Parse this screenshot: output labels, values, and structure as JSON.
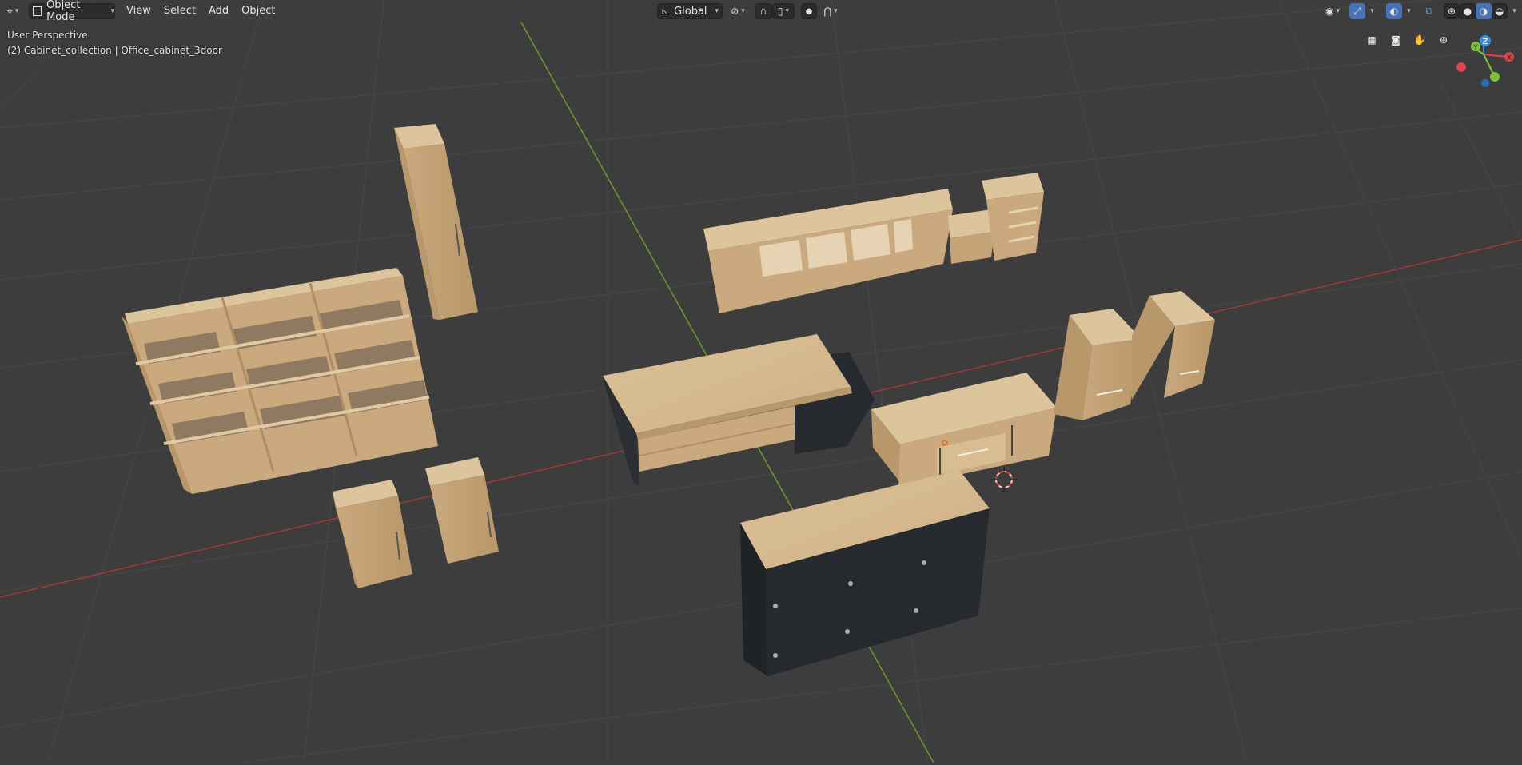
{
  "header": {
    "editor_type_icon": "axes-icon",
    "mode_label": "Object Mode",
    "menus": [
      "View",
      "Select",
      "Add",
      "Object"
    ],
    "transform_orientation": "Global"
  },
  "viewport": {
    "perspective_label": "User Perspective",
    "collection_label": "(2) Cabinet_collection | Office_cabinet_3door"
  },
  "gizmo": {
    "x_label": "X",
    "y_label": "Y",
    "z_label": "Z",
    "colors": {
      "x": "#e0424f",
      "y": "#7dc23a",
      "z": "#3d8ee0"
    }
  },
  "colors": {
    "background": "#3d3d3d",
    "grid": "#474747",
    "x_axis": "#9c3a3d",
    "y_axis": "#6c9a2a",
    "wood_top": "#d7bc92",
    "wood_side": "#c4a377",
    "dark_panel": "#262a2e",
    "accent": "#4772b3"
  }
}
